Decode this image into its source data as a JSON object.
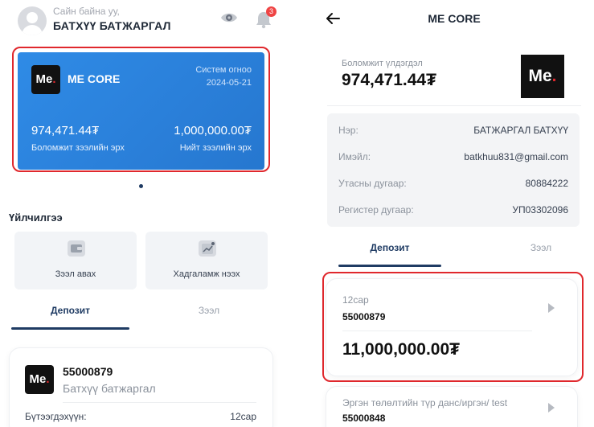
{
  "left": {
    "header": {
      "greeting": "Сайн байна уу,",
      "username": "БАТХҮҮ БАТЖАРГАЛ",
      "notification_count": "3"
    },
    "card": {
      "logo_text": "Me",
      "logo_dot": ".",
      "title": "ME CORE",
      "system_label": "Систем огноо",
      "system_date": "2024-05-21",
      "available_amount": "974,471.44₮",
      "available_label": "Боломжит зээлийн эрх",
      "total_amount": "1,000,000.00₮",
      "total_label": "Нийт зээлийн эрх"
    },
    "services_title": "Үйлчилгээ",
    "services": [
      {
        "label": "Зээл авах",
        "icon": "wallet-icon"
      },
      {
        "label": "Хадгаламж нээх",
        "icon": "chart-icon"
      }
    ],
    "tabs": [
      "Депозит",
      "Зээл"
    ],
    "deposit": {
      "logo_text": "Me",
      "logo_dot": ".",
      "account": "55000879",
      "name": "Батхүү батжаргал",
      "product_label": "Бүтээгдэхүүн:",
      "product_value": "12сар"
    }
  },
  "right": {
    "title": "ME CORE",
    "available_label": "Боломжит үлдэгдэл",
    "available_amount": "974,471.44₮",
    "logo_text": "Me",
    "logo_dot": ".",
    "info": [
      {
        "label": "Нэр:",
        "value": "БАТЖАРГАЛ БАТХҮҮ"
      },
      {
        "label": "Имэйл:",
        "value": "batkhuu831@gmail.com"
      },
      {
        "label": "Утасны дугаар:",
        "value": "80884222"
      },
      {
        "label": "Регистер дугаар:",
        "value": "УП03302096"
      }
    ],
    "tabs": [
      "Депозит",
      "Зээл"
    ],
    "deposits": [
      {
        "period": "12сар",
        "account": "55000879",
        "amount": "11,000,000.00₮"
      },
      {
        "period": "Эргэн төлөлтийн түр данс/иргэн/ test",
        "account": "55000848"
      }
    ]
  },
  "colors": {
    "accent": "#1f3b63",
    "card_blue": "#2a7fd9",
    "highlight_red": "#e0282d",
    "badge_red": "#ef4444"
  }
}
